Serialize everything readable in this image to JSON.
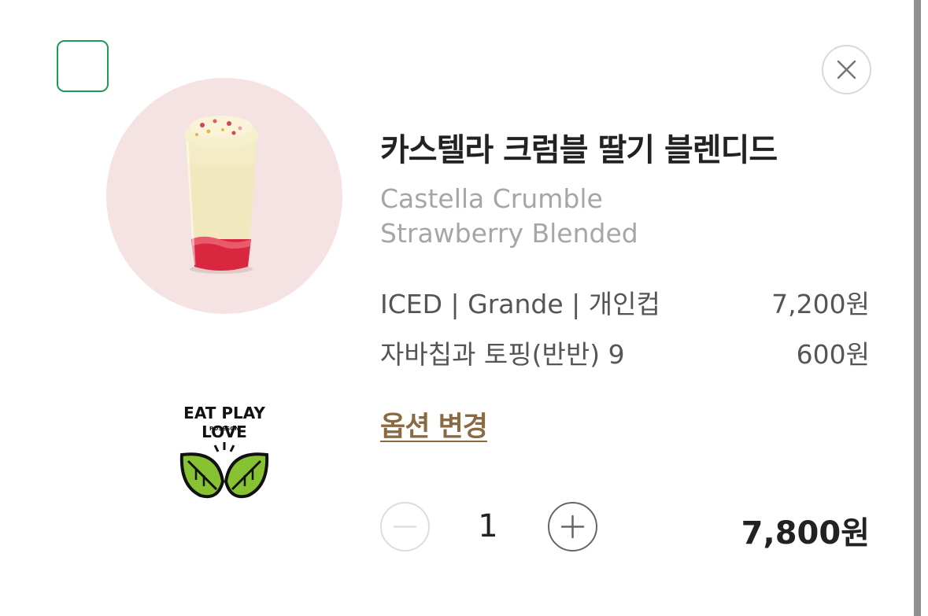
{
  "product": {
    "name_ko": "카스텔라 크럼블 딸기 블렌디드",
    "name_en": "Castella Crumble Strawberry Blended",
    "image": "castella-strawberry-blended-drink"
  },
  "brand": {
    "title": "EAT PLAY LOVE",
    "subtitle": "ROSESON",
    "icon": "green-leaves-logo"
  },
  "options": [
    {
      "label": "ICED | Grande | 개인컵",
      "price": "7,200원"
    },
    {
      "label": "자바칩과 토핑(반반) 9",
      "price": "600원"
    }
  ],
  "change_option_label": "옵션 변경",
  "quantity": "1",
  "total_price": "7,800원",
  "selected": false,
  "colors": {
    "checkbox_border": "#1f9a58",
    "link": "#8a6a43",
    "image_bg": "#f5e3e3"
  }
}
